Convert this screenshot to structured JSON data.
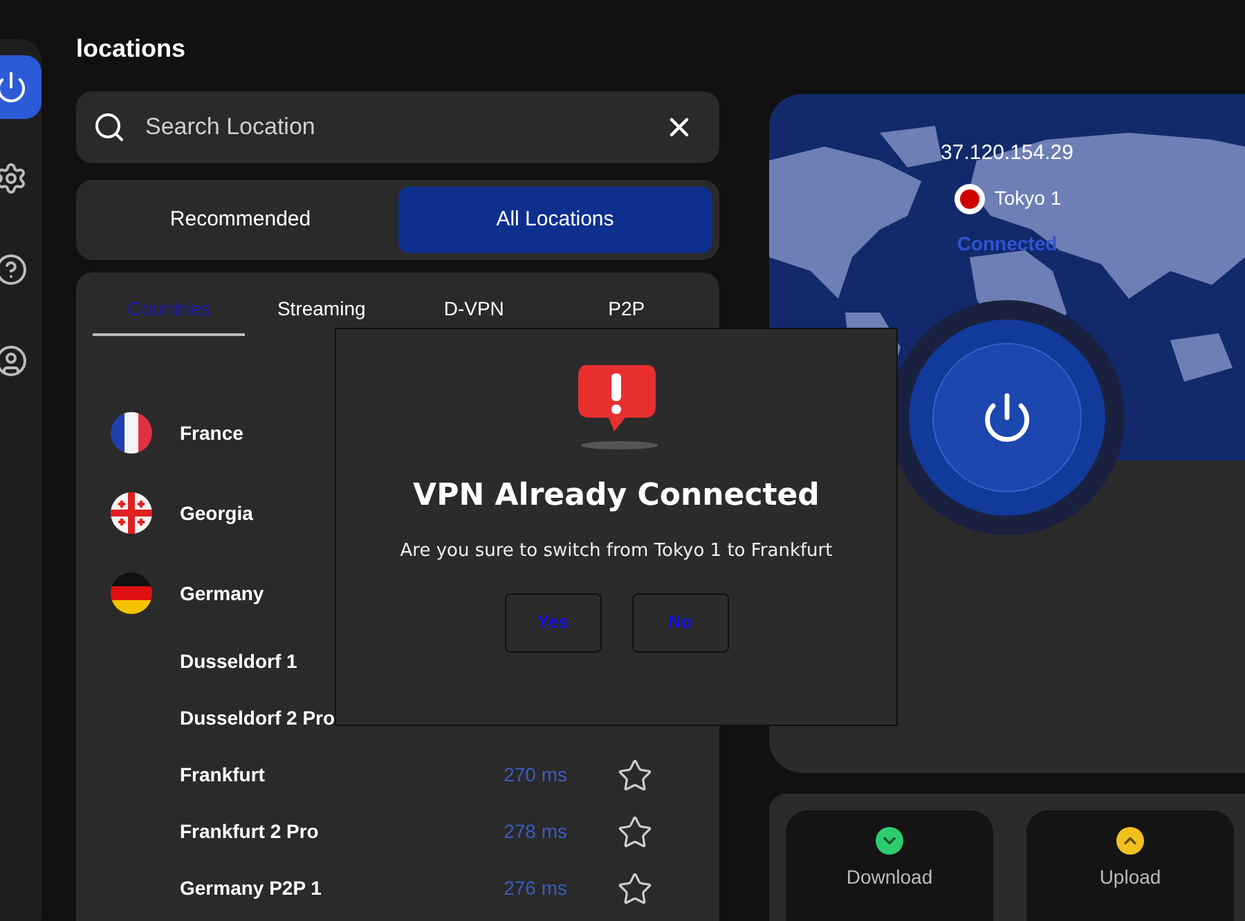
{
  "sidebar": {
    "items": [
      {
        "kind": "power",
        "selected": true
      },
      {
        "kind": "settings",
        "selected": false
      },
      {
        "kind": "help",
        "selected": false
      },
      {
        "kind": "account",
        "selected": false
      }
    ]
  },
  "title": "locations",
  "search": {
    "placeholder": "Search Location"
  },
  "segments": [
    {
      "label": "Recommended",
      "selected": false
    },
    {
      "label": "All Locations",
      "selected": true
    }
  ],
  "tabs": [
    {
      "label": "Countries",
      "selected": true
    },
    {
      "label": "Streaming",
      "selected": false
    },
    {
      "label": "D-VPN",
      "selected": false
    },
    {
      "label": "P2P",
      "selected": false
    }
  ],
  "locations": [
    {
      "kind": "fr",
      "name": "France"
    },
    {
      "kind": "ge",
      "name": "Georgia"
    },
    {
      "kind": "de",
      "name": "Germany"
    },
    {
      "kind": "city",
      "name": "Dusseldorf 1"
    },
    {
      "kind": "city",
      "name": "Dusseldorf 2 Pro"
    },
    {
      "kind": "city",
      "name": "Frankfurt",
      "ping": "270 ms",
      "favorite": false
    },
    {
      "kind": "city",
      "name": "Frankfurt 2 Pro",
      "ping": "278 ms",
      "favorite": false
    },
    {
      "kind": "city",
      "name": "Germany P2P 1",
      "ping": "276 ms",
      "favorite": false
    }
  ],
  "dialog": {
    "title": "VPN Already Connected",
    "message": "Are you sure to switch from Tokyo 1 to Frankfurt",
    "buttons": [
      "Yes",
      "No"
    ]
  },
  "status": {
    "ip": "37.120.154.29",
    "server": "Tokyo 1",
    "state": "Connected",
    "connected": true
  },
  "speed": [
    {
      "kind": "download",
      "label": "Download"
    },
    {
      "kind": "upload",
      "label": "Upload"
    }
  ]
}
